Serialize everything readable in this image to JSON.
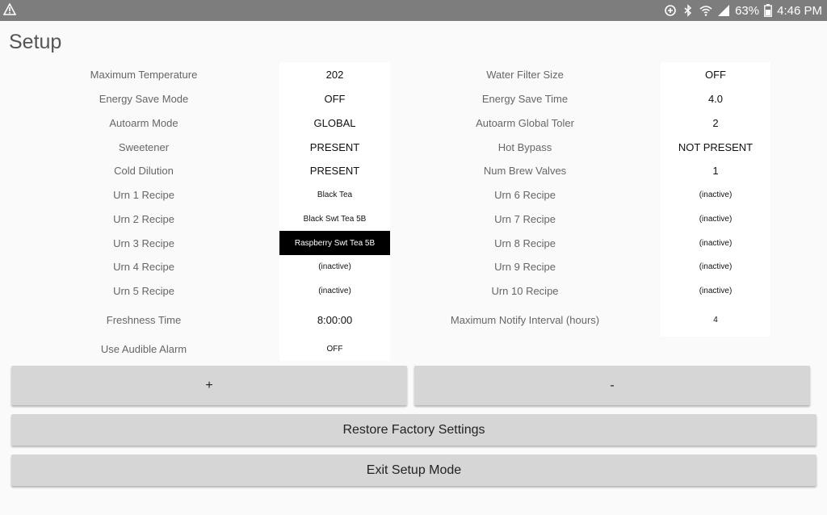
{
  "status_bar": {
    "battery_percent": "63%",
    "time": "4:46 PM",
    "icons": [
      "warning-icon",
      "data-saver-icon",
      "bluetooth-icon",
      "wifi-icon",
      "signal-icon",
      "battery-icon"
    ]
  },
  "page": {
    "title": "Setup"
  },
  "settings_left": [
    {
      "label": "Maximum Temperature",
      "value": "202"
    },
    {
      "label": "Energy Save Mode",
      "value": "OFF"
    },
    {
      "label": "Autoarm Mode",
      "value": "GLOBAL"
    },
    {
      "label": "Sweetener",
      "value": "PRESENT"
    },
    {
      "label": "Cold Dilution",
      "value": "PRESENT"
    },
    {
      "label": "Urn 1 Recipe",
      "value": "Black Tea"
    },
    {
      "label": "Urn 2 Recipe",
      "value": "Black Swt Tea 5B"
    },
    {
      "label": "Urn 3 Recipe",
      "value": "Raspberry Swt Tea 5B",
      "selected": true
    },
    {
      "label": "Urn 4 Recipe",
      "value": "(inactive)"
    },
    {
      "label": "Urn 5 Recipe",
      "value": "(inactive)"
    },
    {
      "label": "Freshness Time",
      "value": "8:00:00"
    },
    {
      "label": "Use Audible Alarm",
      "value": "OFF"
    }
  ],
  "settings_right": [
    {
      "label": "Water Filter Size",
      "value": "OFF"
    },
    {
      "label": "Energy Save Time",
      "value": "4.0"
    },
    {
      "label": "Autoarm Global Toler",
      "value": "2"
    },
    {
      "label": "Hot Bypass",
      "value": "NOT PRESENT"
    },
    {
      "label": "Num Brew Valves",
      "value": "1"
    },
    {
      "label": "Urn 6 Recipe",
      "value": "(inactive)"
    },
    {
      "label": "Urn 7 Recipe",
      "value": "(inactive)"
    },
    {
      "label": "Urn 8 Recipe",
      "value": "(inactive)"
    },
    {
      "label": "Urn 9 Recipe",
      "value": "(inactive)"
    },
    {
      "label": "Urn 10 Recipe",
      "value": "(inactive)"
    },
    {
      "label": "Maximum Notify Interval (hours)",
      "value": "4"
    }
  ],
  "buttons": {
    "plus": "+",
    "minus": "-",
    "restore": "Restore Factory Settings",
    "exit": "Exit Setup Mode"
  }
}
